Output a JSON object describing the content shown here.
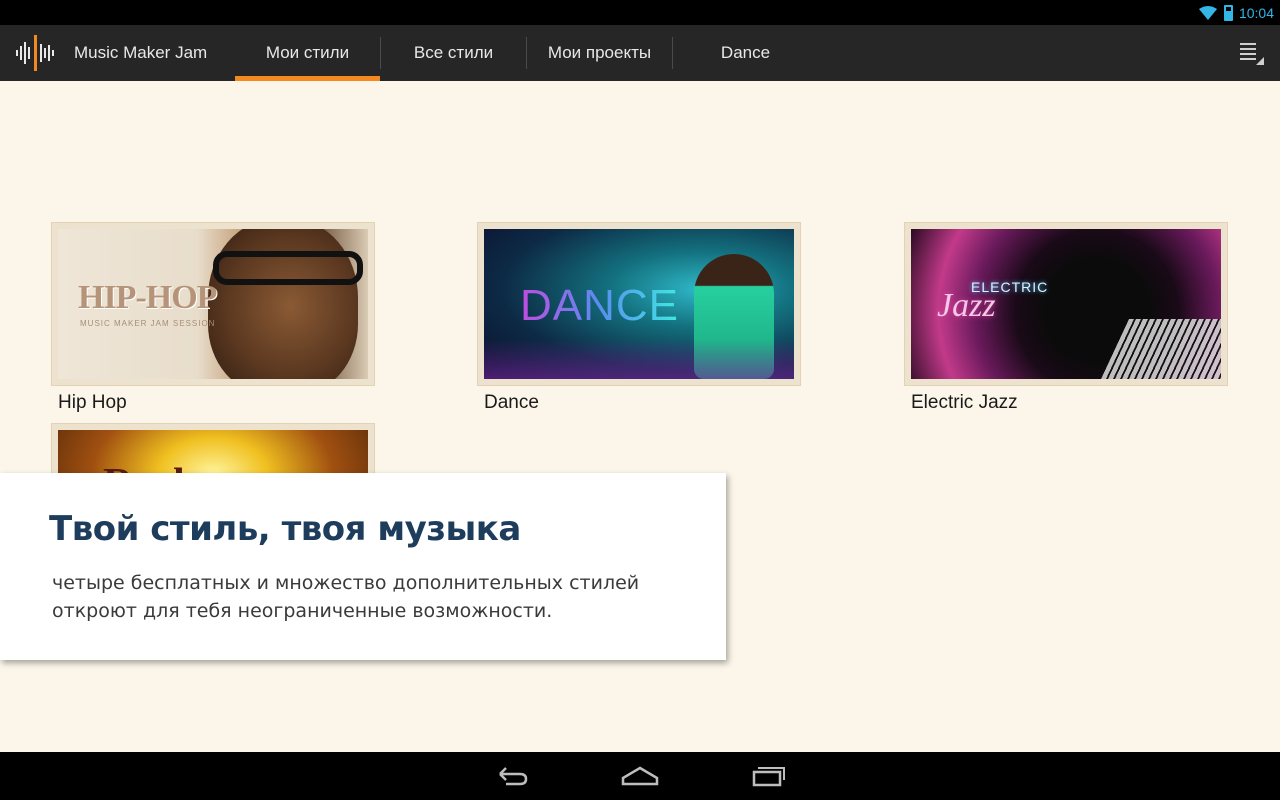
{
  "status_bar": {
    "time": "10:04",
    "accent_color": "#33b5e5"
  },
  "action_bar": {
    "app_title": "Music Maker Jam",
    "tabs": [
      {
        "label": "Мои стили",
        "active": true
      },
      {
        "label": "Все стили",
        "active": false
      },
      {
        "label": "Мои проекты",
        "active": false
      },
      {
        "label": "Dance",
        "active": false
      }
    ],
    "accent_color": "#f4891f",
    "overflow_icon": "overflow-menu-icon"
  },
  "styles": [
    {
      "label": "Hip Hop",
      "art_title": "HIP-HOP",
      "art_subtitle": "MUSIC MAKER JAM SESSION"
    },
    {
      "label": "Dance",
      "art_title": "DANCE"
    },
    {
      "label": "Electric Jazz",
      "art_title": "ELECTRIC",
      "art_script": "Jazz"
    },
    {
      "art_title": "Rock"
    }
  ],
  "promo": {
    "title": "Твой стиль, твоя музыка",
    "text": "четыре бесплатных и множество дополнительных стилей откроют для тебя неограниченные возможности."
  },
  "nav_bar": {
    "icons": [
      "back-icon",
      "home-icon",
      "recent-apps-icon"
    ]
  }
}
